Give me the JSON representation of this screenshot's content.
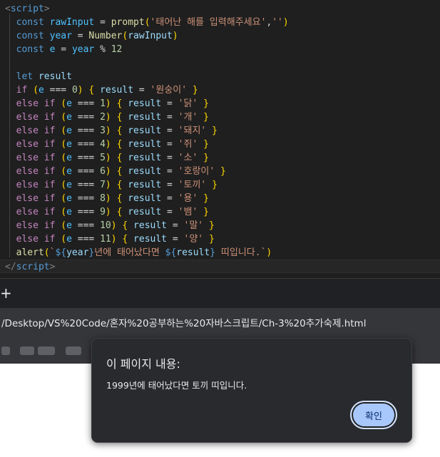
{
  "editor": {
    "lines": [
      [
        [
          "t-br",
          "<"
        ],
        [
          "t-tag",
          "script"
        ],
        [
          "t-br",
          ">"
        ]
      ],
      [
        [
          "t-def",
          "  "
        ],
        [
          "t-kw",
          "const"
        ],
        [
          "t-def",
          " "
        ],
        [
          "t-con",
          "rawInput"
        ],
        [
          "t-def",
          " = "
        ],
        [
          "t-fn",
          "prompt"
        ],
        [
          "t-p1",
          "("
        ],
        [
          "t-str",
          "'태어난 해를 입력해주세요'"
        ],
        [
          "t-def",
          ","
        ],
        [
          "t-str",
          "''"
        ],
        [
          "t-p1",
          ")"
        ]
      ],
      [
        [
          "t-def",
          "  "
        ],
        [
          "t-kw",
          "const"
        ],
        [
          "t-def",
          " "
        ],
        [
          "t-con",
          "year"
        ],
        [
          "t-def",
          " = "
        ],
        [
          "t-fn",
          "Number"
        ],
        [
          "t-p1",
          "("
        ],
        [
          "t-var",
          "rawInput"
        ],
        [
          "t-p1",
          ")"
        ]
      ],
      [
        [
          "t-def",
          "  "
        ],
        [
          "t-kw",
          "const"
        ],
        [
          "t-def",
          " "
        ],
        [
          "t-con",
          "e"
        ],
        [
          "t-def",
          " = "
        ],
        [
          "t-con",
          "year"
        ],
        [
          "t-def",
          " % "
        ],
        [
          "t-num",
          "12"
        ]
      ],
      [
        [
          "t-def",
          ""
        ]
      ],
      [
        [
          "t-def",
          "  "
        ],
        [
          "t-kw",
          "let"
        ],
        [
          "t-def",
          " "
        ],
        [
          "t-var",
          "result"
        ]
      ],
      [
        [
          "t-def",
          "  "
        ],
        [
          "t-ctl",
          "if"
        ],
        [
          "t-def",
          " "
        ],
        [
          "t-p1",
          "("
        ],
        [
          "t-con",
          "e"
        ],
        [
          "t-def",
          " === "
        ],
        [
          "t-num",
          "0"
        ],
        [
          "t-p1",
          ")"
        ],
        [
          "t-def",
          " "
        ],
        [
          "t-p1",
          "{"
        ],
        [
          "t-def",
          " "
        ],
        [
          "t-var",
          "result"
        ],
        [
          "t-def",
          " = "
        ],
        [
          "t-str",
          "'원숭이'"
        ],
        [
          "t-def",
          " "
        ],
        [
          "t-p1",
          "}"
        ]
      ],
      [
        [
          "t-def",
          "  "
        ],
        [
          "t-ctl",
          "else if"
        ],
        [
          "t-def",
          " "
        ],
        [
          "t-p1",
          "("
        ],
        [
          "t-con",
          "e"
        ],
        [
          "t-def",
          " === "
        ],
        [
          "t-num",
          "1"
        ],
        [
          "t-p1",
          ")"
        ],
        [
          "t-def",
          " "
        ],
        [
          "t-p1",
          "{"
        ],
        [
          "t-def",
          " "
        ],
        [
          "t-var",
          "result"
        ],
        [
          "t-def",
          " = "
        ],
        [
          "t-str",
          "'닭'"
        ],
        [
          "t-def",
          " "
        ],
        [
          "t-p1",
          "}"
        ]
      ],
      [
        [
          "t-def",
          "  "
        ],
        [
          "t-ctl",
          "else if"
        ],
        [
          "t-def",
          " "
        ],
        [
          "t-p1",
          "("
        ],
        [
          "t-con",
          "e"
        ],
        [
          "t-def",
          " === "
        ],
        [
          "t-num",
          "2"
        ],
        [
          "t-p1",
          ")"
        ],
        [
          "t-def",
          " "
        ],
        [
          "t-p1",
          "{"
        ],
        [
          "t-def",
          " "
        ],
        [
          "t-var",
          "result"
        ],
        [
          "t-def",
          " = "
        ],
        [
          "t-str",
          "'개'"
        ],
        [
          "t-def",
          " "
        ],
        [
          "t-p1",
          "}"
        ]
      ],
      [
        [
          "t-def",
          "  "
        ],
        [
          "t-ctl",
          "else if"
        ],
        [
          "t-def",
          " "
        ],
        [
          "t-p1",
          "("
        ],
        [
          "t-con",
          "e"
        ],
        [
          "t-def",
          " === "
        ],
        [
          "t-num",
          "3"
        ],
        [
          "t-p1",
          ")"
        ],
        [
          "t-def",
          " "
        ],
        [
          "t-p1",
          "{"
        ],
        [
          "t-def",
          " "
        ],
        [
          "t-var",
          "result"
        ],
        [
          "t-def",
          " = "
        ],
        [
          "t-str",
          "'돼지'"
        ],
        [
          "t-def",
          " "
        ],
        [
          "t-p1",
          "}"
        ]
      ],
      [
        [
          "t-def",
          "  "
        ],
        [
          "t-ctl",
          "else if"
        ],
        [
          "t-def",
          " "
        ],
        [
          "t-p1",
          "("
        ],
        [
          "t-con",
          "e"
        ],
        [
          "t-def",
          " === "
        ],
        [
          "t-num",
          "4"
        ],
        [
          "t-p1",
          ")"
        ],
        [
          "t-def",
          " "
        ],
        [
          "t-p1",
          "{"
        ],
        [
          "t-def",
          " "
        ],
        [
          "t-var",
          "result"
        ],
        [
          "t-def",
          " = "
        ],
        [
          "t-str",
          "'쥐'"
        ],
        [
          "t-def",
          " "
        ],
        [
          "t-p1",
          "}"
        ]
      ],
      [
        [
          "t-def",
          "  "
        ],
        [
          "t-ctl",
          "else if"
        ],
        [
          "t-def",
          " "
        ],
        [
          "t-p1",
          "("
        ],
        [
          "t-con",
          "e"
        ],
        [
          "t-def",
          " === "
        ],
        [
          "t-num",
          "5"
        ],
        [
          "t-p1",
          ")"
        ],
        [
          "t-def",
          " "
        ],
        [
          "t-p1",
          "{"
        ],
        [
          "t-def",
          " "
        ],
        [
          "t-var",
          "result"
        ],
        [
          "t-def",
          " = "
        ],
        [
          "t-str",
          "'소'"
        ],
        [
          "t-def",
          " "
        ],
        [
          "t-p1",
          "}"
        ]
      ],
      [
        [
          "t-def",
          "  "
        ],
        [
          "t-ctl",
          "else if"
        ],
        [
          "t-def",
          " "
        ],
        [
          "t-p1",
          "("
        ],
        [
          "t-con",
          "e"
        ],
        [
          "t-def",
          " === "
        ],
        [
          "t-num",
          "6"
        ],
        [
          "t-p1",
          ")"
        ],
        [
          "t-def",
          " "
        ],
        [
          "t-p1",
          "{"
        ],
        [
          "t-def",
          " "
        ],
        [
          "t-var",
          "result"
        ],
        [
          "t-def",
          " = "
        ],
        [
          "t-str",
          "'호랑이'"
        ],
        [
          "t-def",
          " "
        ],
        [
          "t-p1",
          "}"
        ]
      ],
      [
        [
          "t-def",
          "  "
        ],
        [
          "t-ctl",
          "else if"
        ],
        [
          "t-def",
          " "
        ],
        [
          "t-p1",
          "("
        ],
        [
          "t-con",
          "e"
        ],
        [
          "t-def",
          " === "
        ],
        [
          "t-num",
          "7"
        ],
        [
          "t-p1",
          ")"
        ],
        [
          "t-def",
          " "
        ],
        [
          "t-p1",
          "{"
        ],
        [
          "t-def",
          " "
        ],
        [
          "t-var",
          "result"
        ],
        [
          "t-def",
          " = "
        ],
        [
          "t-str",
          "'토끼'"
        ],
        [
          "t-def",
          " "
        ],
        [
          "t-p1",
          "}"
        ]
      ],
      [
        [
          "t-def",
          "  "
        ],
        [
          "t-ctl",
          "else if"
        ],
        [
          "t-def",
          " "
        ],
        [
          "t-p1",
          "("
        ],
        [
          "t-con",
          "e"
        ],
        [
          "t-def",
          " === "
        ],
        [
          "t-num",
          "8"
        ],
        [
          "t-p1",
          ")"
        ],
        [
          "t-def",
          " "
        ],
        [
          "t-p1",
          "{"
        ],
        [
          "t-def",
          " "
        ],
        [
          "t-var",
          "result"
        ],
        [
          "t-def",
          " = "
        ],
        [
          "t-str",
          "'용'"
        ],
        [
          "t-def",
          " "
        ],
        [
          "t-p1",
          "}"
        ]
      ],
      [
        [
          "t-def",
          "  "
        ],
        [
          "t-ctl",
          "else if"
        ],
        [
          "t-def",
          " "
        ],
        [
          "t-p1",
          "("
        ],
        [
          "t-con",
          "e"
        ],
        [
          "t-def",
          " === "
        ],
        [
          "t-num",
          "9"
        ],
        [
          "t-p1",
          ")"
        ],
        [
          "t-def",
          " "
        ],
        [
          "t-p1",
          "{"
        ],
        [
          "t-def",
          " "
        ],
        [
          "t-var",
          "result"
        ],
        [
          "t-def",
          " = "
        ],
        [
          "t-str",
          "'뱀'"
        ],
        [
          "t-def",
          " "
        ],
        [
          "t-p1",
          "}"
        ]
      ],
      [
        [
          "t-def",
          "  "
        ],
        [
          "t-ctl",
          "else if"
        ],
        [
          "t-def",
          " "
        ],
        [
          "t-p1",
          "("
        ],
        [
          "t-con",
          "e"
        ],
        [
          "t-def",
          " === "
        ],
        [
          "t-num",
          "10"
        ],
        [
          "t-p1",
          ")"
        ],
        [
          "t-def",
          " "
        ],
        [
          "t-p1",
          "{"
        ],
        [
          "t-def",
          " "
        ],
        [
          "t-var",
          "result"
        ],
        [
          "t-def",
          " = "
        ],
        [
          "t-str",
          "'말'"
        ],
        [
          "t-def",
          " "
        ],
        [
          "t-p1",
          "}"
        ]
      ],
      [
        [
          "t-def",
          "  "
        ],
        [
          "t-ctl",
          "else if"
        ],
        [
          "t-def",
          " "
        ],
        [
          "t-p1",
          "("
        ],
        [
          "t-con",
          "e"
        ],
        [
          "t-def",
          " === "
        ],
        [
          "t-num",
          "11"
        ],
        [
          "t-p1",
          ")"
        ],
        [
          "t-def",
          " "
        ],
        [
          "t-p1",
          "{"
        ],
        [
          "t-def",
          " "
        ],
        [
          "t-var",
          "result"
        ],
        [
          "t-def",
          " = "
        ],
        [
          "t-str",
          "'양'"
        ],
        [
          "t-def",
          " "
        ],
        [
          "t-p1",
          "}"
        ]
      ],
      [
        [
          "t-def",
          "  "
        ],
        [
          "t-fn",
          "alert"
        ],
        [
          "t-p1",
          "("
        ],
        [
          "t-str",
          "`"
        ],
        [
          "t-tpl",
          "${"
        ],
        [
          "t-var",
          "year"
        ],
        [
          "t-tpl",
          "}"
        ],
        [
          "t-str",
          "년에 태어났다면 "
        ],
        [
          "t-tpl",
          "${"
        ],
        [
          "t-var",
          "result"
        ],
        [
          "t-tpl",
          "}"
        ],
        [
          "t-str",
          " 띠입니다.`"
        ],
        [
          "t-p1",
          ")"
        ]
      ],
      [
        [
          "t-br",
          "</"
        ],
        [
          "t-tag",
          "script"
        ],
        [
          "t-br",
          ">"
        ]
      ]
    ]
  },
  "browser": {
    "new_tab_label": "+",
    "url": "/Desktop/VS%20Code/혼자%20공부하는%20자바스크립트/Ch-3%20추가숙제.html"
  },
  "dialog": {
    "title": "이 페이지 내용:",
    "message": "1999년에 태어났다면 토끼 띠입니다.",
    "ok_label": "확인"
  },
  "colors": {
    "editor_bg": "#1f1f1f",
    "dialog_bg": "#292a2d",
    "ok_button_bg": "#a8c7fa"
  }
}
